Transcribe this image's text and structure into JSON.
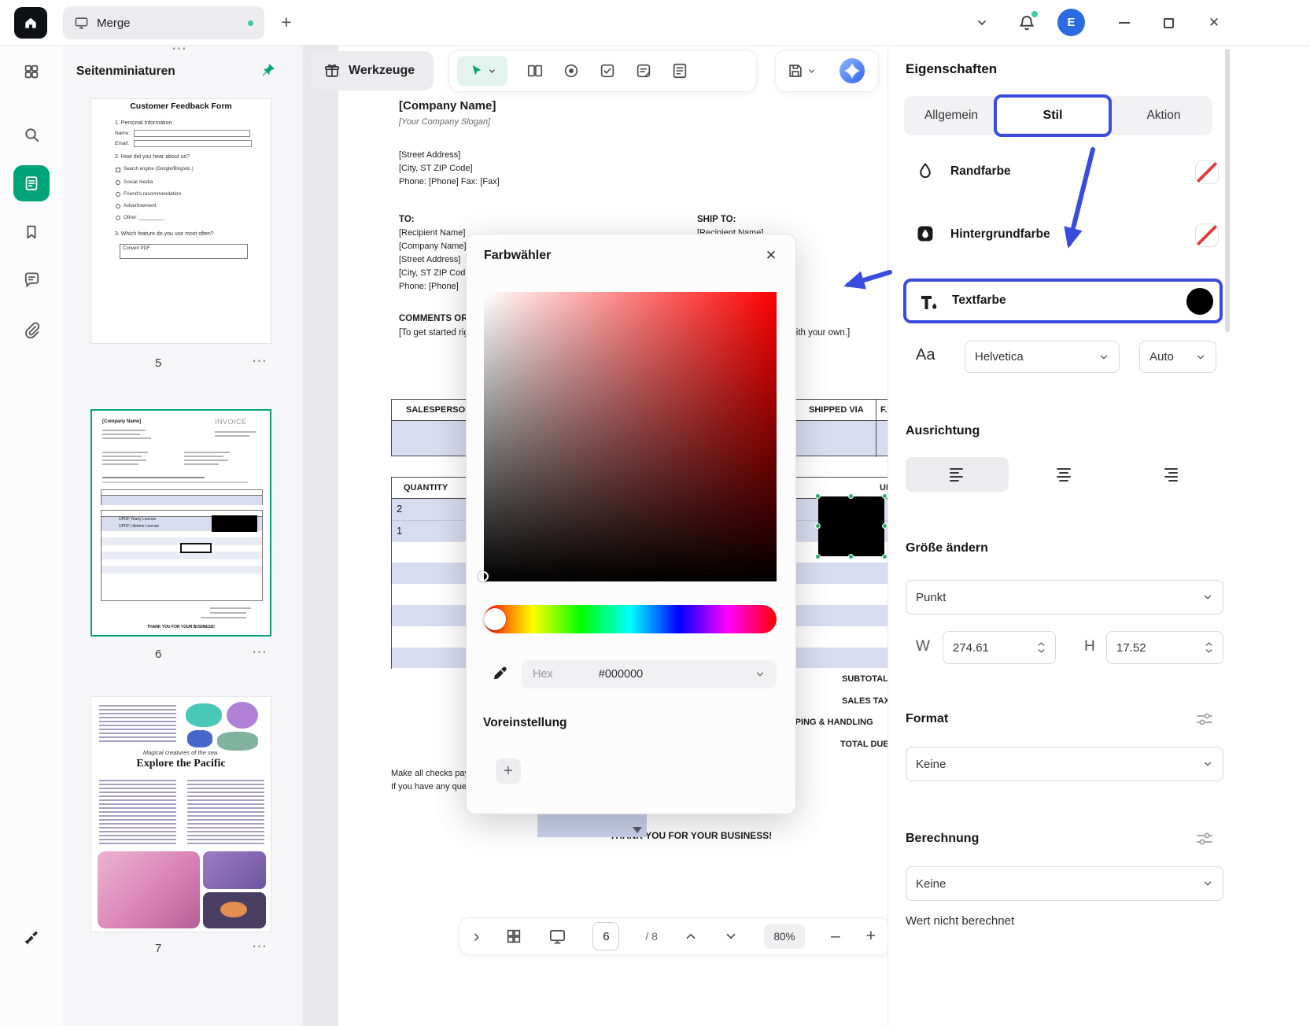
{
  "icons": {
    "more": "⋯",
    "plus": "+",
    "minus": "–",
    "close": "✕",
    "chevron_right": "›"
  },
  "topbar": {
    "tab_title": "Merge",
    "avatar_initial": "E"
  },
  "thumbnails": {
    "panel_title": "Seitenminiaturen",
    "page5": {
      "number": "5",
      "form_title": "Customer Feedback Form",
      "s1": "1. Personal Information",
      "name_label": "Name:",
      "email_label": "Email:",
      "s2": "2. How did you hear about us?",
      "opt1": "Search engine (Google/Bing/etc.)",
      "opt2": "Social media",
      "opt3": "Friend's recommendation",
      "opt4": "Advertisement",
      "opt5": "Other: _________",
      "s3": "3. Which feature do you use most often?",
      "select_value": "Convert PDF"
    },
    "page6": {
      "number": "6",
      "company": "[Company Name]",
      "invoice": "INVOICE",
      "row1": "UPDF Yearly License",
      "row2": "UPDF Lifetime License",
      "thanks": "THANK YOU FOR YOUR BUSINESS!"
    },
    "page7": {
      "number": "7",
      "subtitle": "Magical creatures of the sea.",
      "title": "Explore the Pacific"
    }
  },
  "toolbar": {
    "tools_label": "Werkzeuge"
  },
  "doc": {
    "company": "[Company Name]",
    "slogan": "[Your Company Slogan]",
    "addr1": "[Street Address]",
    "addr2": "[City, ST ZIP Code]",
    "addr3": "Phone: [Phone]  Fax: [Fax]",
    "to_label": "TO:",
    "to1": "[Recipient Name]",
    "to2": "[Company Name]",
    "to3": "[Street Address]",
    "to4": "[City, ST ZIP Code]",
    "to5": "Phone: [Phone]",
    "ship_label": "SHIP TO:",
    "ship1": "[Recipient Name]",
    "comments_label": "COMMENTS OR SPECIAL INSTRUCTIONS:",
    "comments_text": "[To get started right away, just tap any placeholder text (such as this) and start typing to replace it with your own.]",
    "h_salesperson": "SALESPERSON",
    "h_shipped_via": "SHIPPED VIA",
    "h_fob": "F.O.B. POINT",
    "h_quantity": "QUANTITY",
    "h_unit_price": "UNIT PRICE",
    "qty1": "2",
    "qty2": "1",
    "t_subtotal": "SUBTOTAL",
    "t_salestax": "SALES TAX",
    "t_shipping": "SHIPPING & HANDLING",
    "t_total": "TOTAL DUE",
    "note1": "Make all checks payable to [Company Name]",
    "note2": "If you have any questions concerning this invoice, contact [Name, Phone, Email]",
    "thanks": "THANK YOU FOR YOUR BUSINESS!"
  },
  "color_picker": {
    "title": "Farbwähler",
    "hex_label": "Hex",
    "hex_value": "#000000",
    "presets_label": "Voreinstellung"
  },
  "props": {
    "title": "Eigenschaften",
    "tab_general": "Allgemein",
    "tab_style": "Stil",
    "tab_action": "Aktion",
    "border_color": "Randfarbe",
    "bg_color": "Hintergrundfarbe",
    "text_color": "Textfarbe",
    "font_sample": "Aa",
    "font_value": "Helvetica",
    "font_size_value": "Auto",
    "alignment": "Ausrichtung",
    "resize": "Größe ändern",
    "unit_value": "Punkt",
    "w_label": "W",
    "w_value": "274.61",
    "h_label": "H",
    "h_value": "17.52",
    "format": "Format",
    "format_value": "Keine",
    "calc": "Berechnung",
    "calc_value": "Keine",
    "calc_note": "Wert nicht berechnet"
  },
  "statusbar": {
    "page": "6",
    "page_total": "/ 8",
    "zoom": "80%"
  },
  "colors": {
    "accent_green": "#00a478",
    "highlight_blue": "#3a4ce0",
    "lavender": "#d8dcf0",
    "avatar_blue": "#2a6be2",
    "annotation_red": "#e23b3b"
  }
}
